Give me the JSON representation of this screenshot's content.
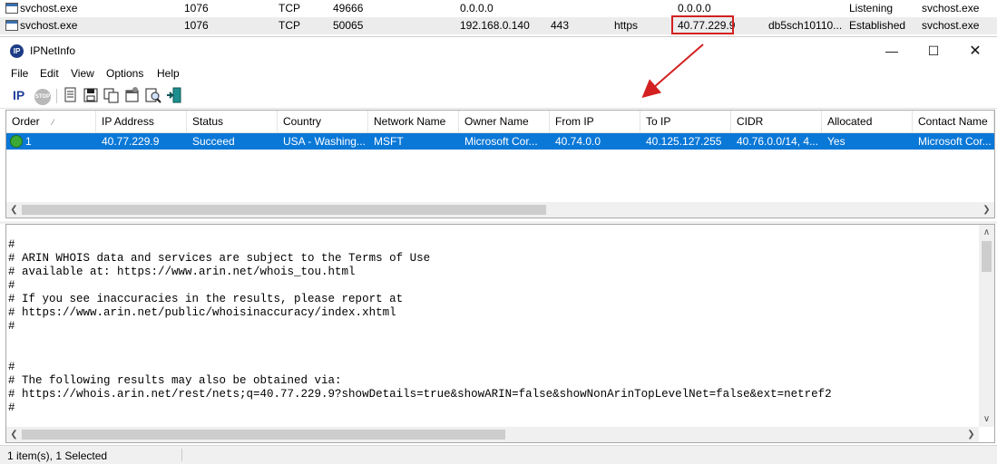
{
  "background_list": {
    "rows": [
      {
        "process": "svchost.exe",
        "pid": "1076",
        "protocol": "TCP",
        "local_port": "49666",
        "local_address": "0.0.0.0",
        "remote_port": "",
        "remote_port_name": "",
        "remote_address": "0.0.0.0",
        "remote_host": "",
        "state": "Listening",
        "process_name": "svchost.exe"
      },
      {
        "process": "svchost.exe",
        "pid": "1076",
        "protocol": "TCP",
        "local_port": "50065",
        "local_address": "192.168.0.140",
        "remote_port": "443",
        "remote_port_name": "https",
        "remote_address": "40.77.229.9",
        "remote_host": "db5sch10110...",
        "state": "Established",
        "process_name": "svchost.exe"
      }
    ],
    "highlight_color": "#d32020"
  },
  "window": {
    "title": "IPNetInfo",
    "controls": {
      "minimize": "—",
      "maximize": "☐",
      "close": "✕"
    }
  },
  "menu": [
    "File",
    "Edit",
    "View",
    "Options",
    "Help"
  ],
  "toolbar": {
    "ip_label": "IP",
    "stop_label": "STOP",
    "icons": [
      "ip-icon",
      "stop-icon",
      "document-icon",
      "save-icon",
      "copy-icon",
      "properties-icon",
      "find-icon",
      "exit-icon"
    ]
  },
  "list": {
    "columns": [
      "Order",
      "IP Address",
      "Status",
      "Country",
      "Network Name",
      "Owner Name",
      "From IP",
      "To IP",
      "CIDR",
      "Allocated",
      "Contact Name"
    ],
    "sort_indicator": "⁄",
    "rows": [
      {
        "order": "1",
        "ip_address": "40.77.229.9",
        "status": "Succeed",
        "country": "USA - Washing...",
        "network_name": "MSFT",
        "owner_name": "Microsoft Cor...",
        "from_ip": "40.74.0.0",
        "to_ip": "40.125.127.255",
        "cidr": "40.76.0.0/14, 4...",
        "allocated": "Yes",
        "contact_name": "Microsoft Cor..."
      }
    ],
    "selection_color": "#0a78d7"
  },
  "whois_text": [
    "#",
    "# ARIN WHOIS data and services are subject to the Terms of Use",
    "# available at: https://www.arin.net/whois_tou.html",
    "#",
    "# If you see inaccuracies in the results, please report at",
    "# https://www.arin.net/public/whoisinaccuracy/index.xhtml",
    "#",
    "",
    "",
    "#",
    "# The following results may also be obtained via:",
    "# https://whois.arin.net/rest/nets;q=40.77.229.9?showDetails=true&showARIN=false&showNonArinTopLevelNet=false&ext=netref2",
    "#"
  ],
  "status_bar": {
    "text": "1 item(s), 1 Selected"
  },
  "annotation": {
    "arrow_color": "#d32020"
  }
}
